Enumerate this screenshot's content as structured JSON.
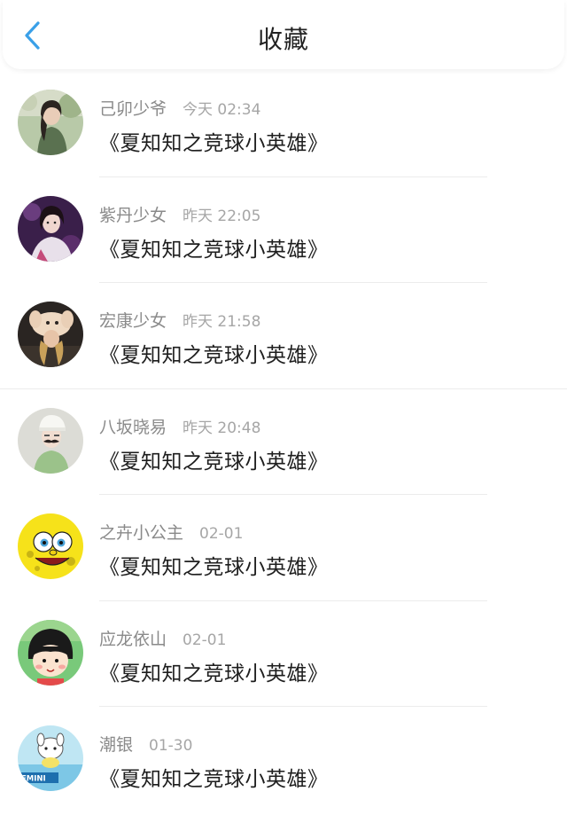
{
  "header": {
    "title": "收藏",
    "back_icon": "chevron-left-icon",
    "accent_color": "#3aa0e8"
  },
  "items": [
    {
      "username": "己卯少爷",
      "time": "今天 02:34",
      "title": "《夏知知之竞球小英雄》",
      "avatar": "avatar-woman-garden"
    },
    {
      "username": "紫丹少女",
      "time": "昨天 22:05",
      "title": "《夏知知之竞球小英雄》",
      "avatar": "avatar-woman-purple"
    },
    {
      "username": "宏康少女",
      "time": "昨天 21:58",
      "title": "《夏知知之竞球小英雄》",
      "avatar": "avatar-rabbit-hat"
    },
    {
      "username": "八坂晓易",
      "time": "昨天 20:48",
      "title": "《夏知知之竞球小英雄》",
      "avatar": "avatar-mustache-cap"
    },
    {
      "username": "之卉小公主",
      "time": "02-01",
      "title": "《夏知知之竞球小英雄》",
      "avatar": "avatar-spongebob"
    },
    {
      "username": "应龙依山",
      "time": "02-01",
      "title": "《夏知知之竞球小英雄》",
      "avatar": "avatar-maruko"
    },
    {
      "username": "潮银",
      "time": "01-30",
      "title": "《夏知知之竞球小英雄》",
      "avatar": "avatar-gemini-cartoon",
      "avatar_text": "EMINI"
    }
  ]
}
